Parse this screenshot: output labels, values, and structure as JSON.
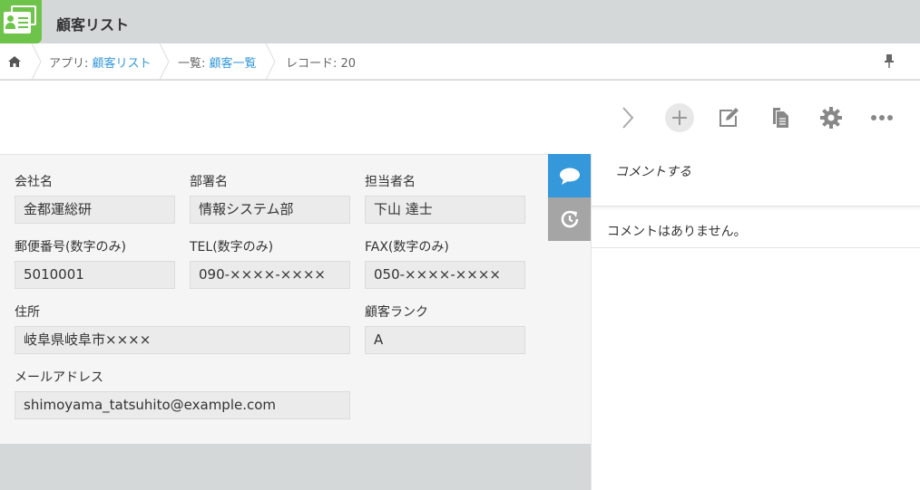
{
  "header": {
    "app_title": "顧客リスト"
  },
  "breadcrumb": {
    "app_prefix": "アプリ: ",
    "app_link": "顧客リスト",
    "view_prefix": "一覧: ",
    "view_link": "顧客一覧",
    "record_label": "レコード: 20"
  },
  "icons": {
    "home": "home-icon",
    "pin": "pin-icon",
    "next": "chevron-right-icon",
    "add": "plus-icon",
    "edit": "edit-icon",
    "duplicate": "duplicate-icon",
    "settings": "gear-icon",
    "more": "more-icon",
    "comment_tab": "speech-bubble-icon",
    "history_tab": "history-icon"
  },
  "record": {
    "company": {
      "label": "会社名",
      "value": "金都運総研"
    },
    "department": {
      "label": "部署名",
      "value": "情報システム部"
    },
    "person": {
      "label": "担当者名",
      "value": "下山 達士"
    },
    "zip": {
      "label": "郵便番号(数字のみ)",
      "value": "5010001"
    },
    "tel": {
      "label": "TEL(数字のみ)",
      "value": "090-××××-××××"
    },
    "fax": {
      "label": "FAX(数字のみ)",
      "value": "050-××××-××××"
    },
    "address": {
      "label": "住所",
      "value": "岐阜県岐阜市××××"
    },
    "rank": {
      "label": "顧客ランク",
      "value": "A"
    },
    "email": {
      "label": "メールアドレス",
      "value": "shimoyama_tatsuhito@example.com"
    }
  },
  "comments": {
    "input_label": "コメントする",
    "empty_text": "コメントはありません。"
  },
  "colors": {
    "accent": "#3498db",
    "app_icon": "#6ec34a",
    "header_bg": "#d5d8d9"
  }
}
